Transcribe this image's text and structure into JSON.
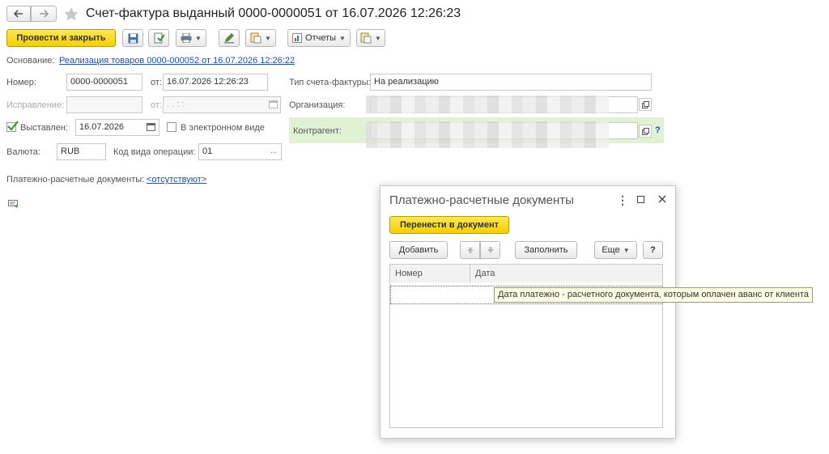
{
  "header": {
    "back_icon": "arrow-left-icon",
    "forward_icon": "arrow-right-icon",
    "favorite_icon": "star-icon",
    "title": "Счет-фактура выданный 0000-0000051 от 16.07.2026 12:26:23"
  },
  "toolbar": {
    "post_close": "Провести и закрыть",
    "reports": "Отчеты"
  },
  "basis": {
    "label": "Основание:",
    "link": "Реализация товаров 0000-000052 от 16.07.2026 12:26:22"
  },
  "form": {
    "number_label": "Номер:",
    "number_value": "0000-0000051",
    "from_label": "от:",
    "date_value": "16.07.2026 12:26:23",
    "invoice_type_label": "Тип счета-фактуры:",
    "invoice_type_value": "На реализацию",
    "correction_label": "Исправление:",
    "correction_from_label": "от:",
    "correction_date_placeholder": " .  .       :  :",
    "organization_label": "Организация:",
    "issued_label": "Выставлен:",
    "issued_date": "16.07.2026",
    "electronic_label": "В электронном виде",
    "counterparty_label": "Контрагент:",
    "help_mark": "?",
    "currency_label": "Валюта:",
    "currency_value": "RUB",
    "op_code_label": "Код вида операции:",
    "op_code_value": "01",
    "ellipsis": "...",
    "payment_docs_label": "Платежно-расчетные документы:",
    "payment_docs_link": "<отсутствуют>"
  },
  "dialog": {
    "title": "Платежно-расчетные документы",
    "transfer_button": "Перенести в документ",
    "add_button": "Добавить",
    "fill_button": "Заполнить",
    "more_button": "Еще",
    "help_button": "?",
    "columns": [
      "Номер",
      "Дата"
    ],
    "tooltip": "Дата платежно - расчетного документа, которым оплачен аванс от клиента"
  },
  "colors": {
    "accent_yellow": "#f4cf00",
    "counterparty_highlight": "#dff2d4",
    "link_blue": "#1b4fa8"
  }
}
